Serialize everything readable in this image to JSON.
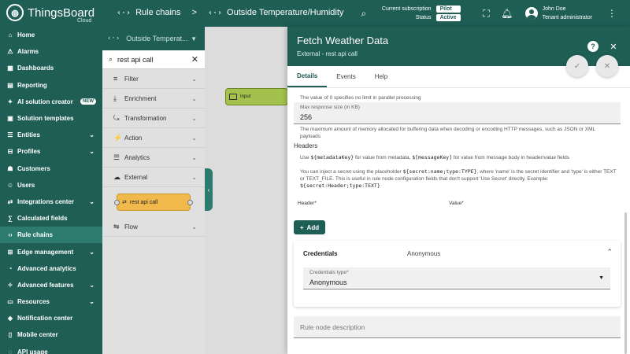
{
  "app": {
    "name": "ThingsBoard",
    "edition": "Cloud"
  },
  "breadcrumbs": [
    "Rule chains",
    "Outside Temperature/Humidity"
  ],
  "header": {
    "subscription_label": "Current subscription",
    "subscription_value": "Pilot",
    "status_label": "Status",
    "status_value": "Active",
    "user_name": "John Doe",
    "user_role": "Tenant administrator"
  },
  "sidebar": {
    "items": [
      {
        "label": "Home",
        "icon": "home-icon"
      },
      {
        "label": "Alarms",
        "icon": "alarm-icon"
      },
      {
        "label": "Dashboards",
        "icon": "dashboard-icon"
      },
      {
        "label": "Reporting",
        "icon": "report-icon"
      },
      {
        "label": "AI solution creator",
        "icon": "ai-icon",
        "badge": "NEW"
      },
      {
        "label": "Solution templates",
        "icon": "template-icon"
      },
      {
        "label": "Entities",
        "icon": "entities-icon",
        "expandable": true
      },
      {
        "label": "Profiles",
        "icon": "profiles-icon",
        "expandable": true
      },
      {
        "label": "Customers",
        "icon": "customers-icon"
      },
      {
        "label": "Users",
        "icon": "users-icon"
      },
      {
        "label": "Integrations center",
        "icon": "integrations-icon",
        "expandable": true
      },
      {
        "label": "Calculated fields",
        "icon": "calc-icon"
      },
      {
        "label": "Rule chains",
        "icon": "rule-chains-icon",
        "active": true
      },
      {
        "label": "Edge management",
        "icon": "edge-icon",
        "expandable": true
      },
      {
        "label": "Advanced analytics",
        "icon": "analytics-icon"
      },
      {
        "label": "Advanced features",
        "icon": "features-icon",
        "expandable": true
      },
      {
        "label": "Resources",
        "icon": "resources-icon",
        "expandable": true
      },
      {
        "label": "Notification center",
        "icon": "notification-icon"
      },
      {
        "label": "Mobile center",
        "icon": "mobile-icon"
      },
      {
        "label": "API usage",
        "icon": "api-icon"
      }
    ]
  },
  "library": {
    "chain_name": "Outside Temperat...",
    "search_value": "rest api call",
    "categories": [
      "Filter",
      "Enrichment",
      "Transformation",
      "Action",
      "Analytics",
      "External",
      "Flow"
    ],
    "node_label": "rest api call"
  },
  "canvas": {
    "input_node_label": "Input"
  },
  "panel": {
    "title": "Fetch Weather Data",
    "subtitle": "External - rest api call",
    "tabs": [
      "Details",
      "Events",
      "Help"
    ],
    "parallel_hint": "The value of 0 specifies no limit in parallel processing",
    "max_response_label": "Max response size (in KB)",
    "max_response_value": "256",
    "max_response_hint": "The maximum amount of memory allocated for buffering data when decoding or encoding HTTP messages, such as JSON or XML payloads",
    "headers_title": "Headers",
    "headers_hint_1a": "Use ",
    "headers_hint_1b": "${metadataKey}",
    "headers_hint_1c": " for value from metadata, ",
    "headers_hint_1d": "$[messageKey]",
    "headers_hint_1e": " for value from message body in header/value fields",
    "headers_hint_2a": "You can inject a secret using the placeholder ",
    "headers_hint_2b": "${secret:name;type:TYPE}",
    "headers_hint_2c": ", where 'name' is the secret identifier and 'type' is either TEXT or TEXT_FILE. This is useful in rule node configuration fields that don't support 'Use Secret' directly. Example: ",
    "headers_hint_2d": "${secret:Header;type:TEXT}",
    "header_col": "Header*",
    "value_col": "Value*",
    "add_label": "Add",
    "credentials_title": "Credentials",
    "credentials_summary": "Anonymous",
    "credentials_type_label": "Credentials type*",
    "credentials_type_value": "Anonymous",
    "description_placeholder": "Rule node description"
  }
}
